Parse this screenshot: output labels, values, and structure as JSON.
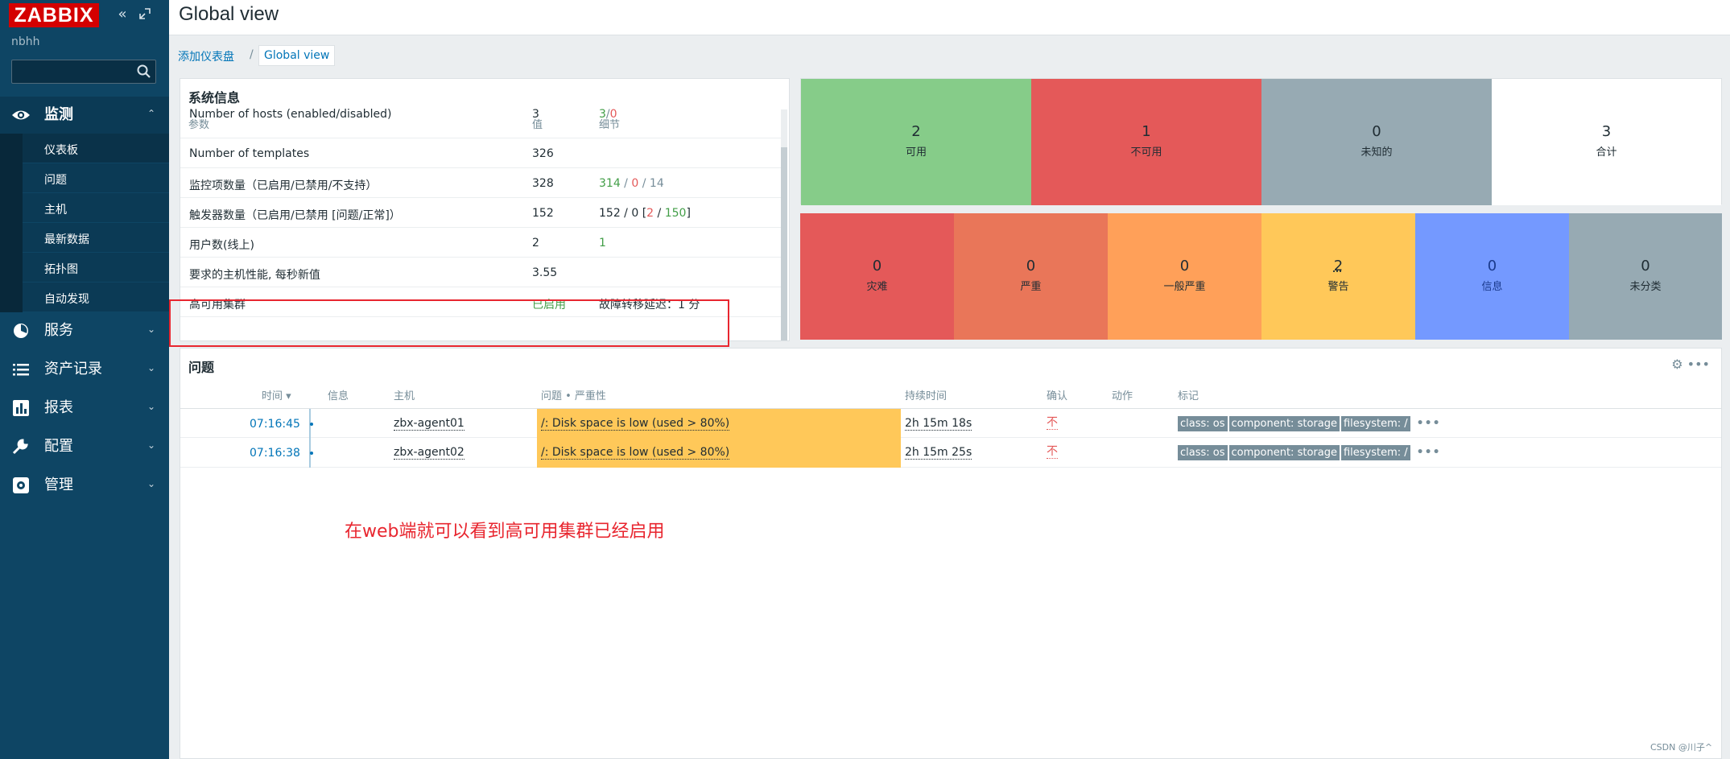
{
  "app": {
    "logo": "ZABBIX",
    "user": "nbhh",
    "collapse_icon": "double-chevron-left-icon",
    "kiosk_icon": "kiosk-mode-icon"
  },
  "header": {
    "title": "Global view"
  },
  "breadcrumb": {
    "parent": "添加仪表盘",
    "separator": "/",
    "current": "Global view"
  },
  "sidebar": {
    "sections": [
      {
        "label": "监测",
        "icon": "eye-icon",
        "expanded": true
      },
      {
        "label": "服务",
        "icon": "services-icon"
      },
      {
        "label": "资产记录",
        "icon": "list-icon"
      },
      {
        "label": "报表",
        "icon": "reports-icon"
      },
      {
        "label": "配置",
        "icon": "wrench-icon"
      },
      {
        "label": "管理",
        "icon": "gear-icon"
      }
    ],
    "monitoring_items": [
      "仪表板",
      "问题",
      "主机",
      "最新数据",
      "拓扑图",
      "自动发现"
    ]
  },
  "system_info": {
    "title": "系统信息",
    "headers": [
      "参数",
      "值",
      "细节"
    ],
    "partial_row": {
      "param": "Number of hosts (enabled/disabled)",
      "value": "3",
      "detail_a": "3",
      "detail_sep": "/",
      "detail_b": "0"
    },
    "rows": [
      {
        "param": "Number of templates",
        "value": "326"
      },
      {
        "param": "监控项数量（已启用/已禁用/不支持）",
        "value": "328",
        "detail": [
          "314",
          " / ",
          "0",
          " / ",
          "14"
        ]
      },
      {
        "param": "触发器数量（已启用/已禁用 [问题/正常]）",
        "value": "152",
        "detail": [
          "152 / 0 [",
          "2",
          " / ",
          "150",
          "]"
        ]
      },
      {
        "param": "用户数(线上)",
        "value": "2",
        "detail": [
          "1"
        ]
      },
      {
        "param": "要求的主机性能, 每秒新值",
        "value": "3.55"
      },
      {
        "param": "高可用集群",
        "value": "已启用",
        "detail": [
          "故障转移延迟：1 分"
        ]
      }
    ]
  },
  "host_availability": [
    {
      "num": "2",
      "cap": "可用",
      "color": "#86cc89"
    },
    {
      "num": "1",
      "cap": "不可用",
      "color": "#e45959"
    },
    {
      "num": "0",
      "cap": "未知的",
      "color": "#97aab3"
    },
    {
      "num": "3",
      "cap": "合计",
      "color": "#ffffff"
    }
  ],
  "severity": [
    {
      "num": "0",
      "cap": "灾难",
      "color": "#e45959"
    },
    {
      "num": "0",
      "cap": "严重",
      "color": "#e97659"
    },
    {
      "num": "0",
      "cap": "一般严重",
      "color": "#ffa059"
    },
    {
      "num": "2",
      "cap": "警告",
      "color": "#ffc859"
    },
    {
      "num": "0",
      "cap": "信息",
      "color": "#7499ff"
    },
    {
      "num": "0",
      "cap": "未分类",
      "color": "#97aab3"
    }
  ],
  "problems": {
    "title": "问题",
    "tools": "⚙ •••",
    "headers": {
      "time": "时间 ▾",
      "info": "信息",
      "host": "主机",
      "problem": "问题 • 严重性",
      "duration": "持续时间",
      "ack": "确认",
      "actions": "动作",
      "tags": "标记"
    },
    "rows": [
      {
        "time": "07:16:45",
        "host": "zbx-agent01",
        "problem": "/: Disk space is low (used > 80%)",
        "duration": "2h 15m 18s",
        "ack": "不",
        "tags": [
          "class: os",
          "component: storage",
          "filesystem: /"
        ]
      },
      {
        "time": "07:16:38",
        "host": "zbx-agent02",
        "problem": "/: Disk space is low (used > 80%)",
        "duration": "2h 15m 25s",
        "ack": "不",
        "tags": [
          "class: os",
          "component: storage",
          "filesystem: /"
        ]
      }
    ]
  },
  "annotation": "在web端就可以看到高可用集群已经启用",
  "watermark": "CSDN @川子^"
}
